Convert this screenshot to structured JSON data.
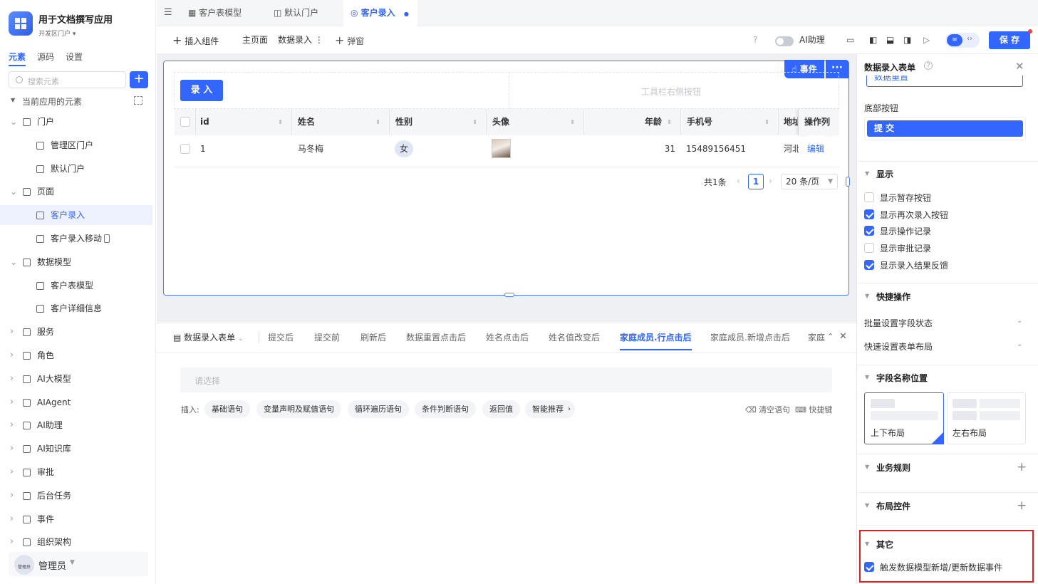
{
  "app": {
    "title": "用于文档撰写应用",
    "env": "开发区门户"
  },
  "sidebar": {
    "tabs": [
      "元素",
      "源码",
      "设置"
    ],
    "search_placeholder": "搜索元素",
    "group_title": "当前应用的元素",
    "items": [
      {
        "label": "门户",
        "level": 0,
        "expanded": true
      },
      {
        "label": "管理区门户",
        "level": 1
      },
      {
        "label": "默认门户",
        "level": 1
      },
      {
        "label": "页面",
        "level": 0,
        "expanded": true
      },
      {
        "label": "客户录入",
        "level": 1,
        "selected": true
      },
      {
        "label": "客户录入移动",
        "level": 1
      },
      {
        "label": "数据模型",
        "level": 0,
        "expanded": true
      },
      {
        "label": "客户表模型",
        "level": 1
      },
      {
        "label": "客户详细信息",
        "level": 1
      },
      {
        "label": "服务",
        "level": 0
      },
      {
        "label": "角色",
        "level": 0
      },
      {
        "label": "AI大模型",
        "level": 0
      },
      {
        "label": "AIAgent",
        "level": 0
      },
      {
        "label": "AI助理",
        "level": 0
      },
      {
        "label": "AI知识库",
        "level": 0
      },
      {
        "label": "审批",
        "level": 0
      },
      {
        "label": "后台任务",
        "level": 0
      },
      {
        "label": "事件",
        "level": 0
      },
      {
        "label": "组织架构",
        "level": 0
      }
    ],
    "user": {
      "name": "管理员",
      "avatar_text": "管理员"
    }
  },
  "tabs": [
    {
      "label": "客户表模型"
    },
    {
      "label": "默认门户"
    },
    {
      "label": "客户录入",
      "active": true
    }
  ],
  "toolbar": {
    "insert": "插入组件",
    "main_page": "主页面",
    "data_entry": "数据录入",
    "popup": "弹窗",
    "ai_assist": "AI助理",
    "save": "保 存"
  },
  "form": {
    "event_btn": "事件",
    "enter_btn": "录 入",
    "toolbar_right_placeholder": "工具栏右侧按钮",
    "columns": [
      "id",
      "姓名",
      "性别",
      "头像",
      "年龄",
      "手机号",
      "地址",
      "操作列"
    ],
    "rows": [
      {
        "id": "1",
        "name": "马冬梅",
        "gender": "女",
        "age": "31",
        "phone": "15489156451",
        "addr": "河北",
        "action": "编辑"
      }
    ],
    "pagination": {
      "total": "共1条",
      "page": "1",
      "size": "20 条/页"
    }
  },
  "event_editor": {
    "title": "数据录入表单",
    "tabs": [
      "提交后",
      "提交前",
      "刷新后",
      "数据重置点击后",
      "姓名点击后",
      "姓名值改变后",
      "家庭成员.行点击后",
      "家庭成员.新增点击后",
      "家庭"
    ],
    "active_tab": "家庭成员.行点击后",
    "select_placeholder": "请选择",
    "insert_label": "插入:",
    "insert_items": [
      "基础语句",
      "变量声明及赋值语句",
      "循环遍历语句",
      "条件判断语句",
      "返回值",
      "智能推荐"
    ],
    "clear": "清空语句",
    "shortcut": "快捷键"
  },
  "props": {
    "title": "数据录入表单",
    "reset_btn_value": "数据重置",
    "bottom_buttons_label": "底部按钮",
    "submit_btn": "提 交",
    "display_section": "显示",
    "display_options": [
      {
        "label": "显示暂存按钮",
        "checked": false
      },
      {
        "label": "显示再次录入按钮",
        "checked": true
      },
      {
        "label": "显示操作记录",
        "checked": true
      },
      {
        "label": "显示审批记录",
        "checked": false
      },
      {
        "label": "显示录入结果反馈",
        "checked": true
      }
    ],
    "quick_section": "快捷操作",
    "quick_items": [
      "批量设置字段状态",
      "快速设置表单布局"
    ],
    "field_pos_section": "字段名称位置",
    "layouts": [
      {
        "label": "上下布局",
        "selected": true
      },
      {
        "label": "左右布局",
        "selected": false
      }
    ],
    "rules_section": "业务规则",
    "layout_ctrl_section": "布局控件",
    "other_section": "其它",
    "other_option": {
      "label": "触发数据模型新增/更新数据事件",
      "checked": true
    }
  },
  "colors": {
    "primary": "#3366ff",
    "highlight": "#e02020"
  }
}
